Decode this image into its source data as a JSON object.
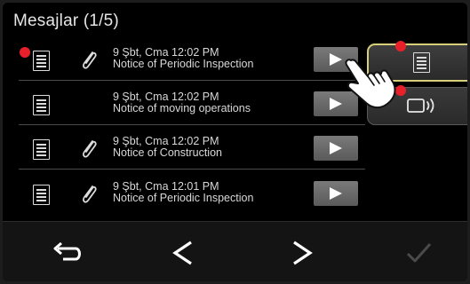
{
  "header": {
    "title": "Mesajlar (1/5)"
  },
  "messages": [
    {
      "date": "9 Şbt, Cma 12:02 PM",
      "title": "Notice of Periodic Inspection",
      "attachment": true,
      "unread": true
    },
    {
      "date": "9 Şbt, Cma 12:02 PM",
      "title": "Notice of moving operations",
      "attachment": false,
      "unread": false
    },
    {
      "date": "9 Şbt, Cma 12:02 PM",
      "title": "Notice of Construction",
      "attachment": true,
      "unread": false
    },
    {
      "date": "9 Şbt, Cma 12:01 PM",
      "title": "Notice of Periodic Inspection",
      "attachment": true,
      "unread": false
    }
  ],
  "side_tabs": [
    {
      "icon": "document-list-icon",
      "selected": true,
      "has_notification": true
    },
    {
      "icon": "audio-message-icon",
      "selected": false,
      "has_notification": true
    }
  ],
  "nav": [
    {
      "icon": "back-icon",
      "enabled": true
    },
    {
      "icon": "previous-icon",
      "enabled": true
    },
    {
      "icon": "next-icon",
      "enabled": true
    },
    {
      "icon": "confirm-check-icon",
      "enabled": false
    }
  ],
  "colors": {
    "background": "#000000",
    "notification_dot": "#e8202a",
    "selected_outline": "#d8cf7a",
    "button_gray": "#6a6a6a",
    "disabled_icon": "#4a4a4a"
  }
}
